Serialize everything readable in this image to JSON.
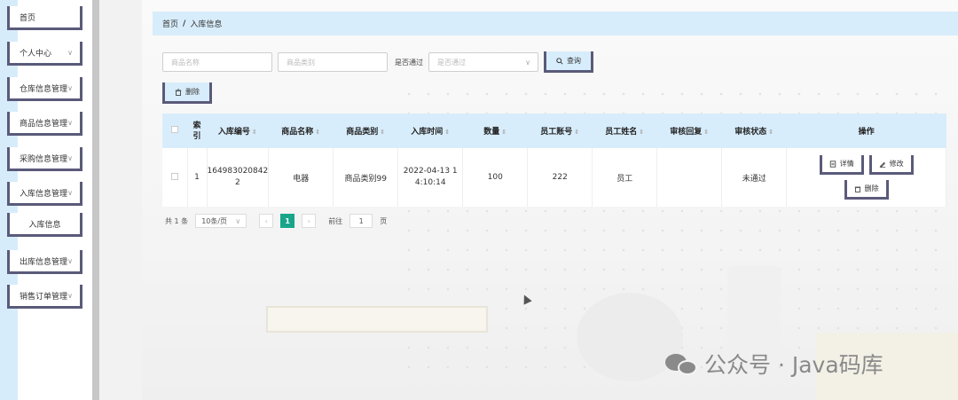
{
  "sidebar": {
    "items": [
      {
        "label": "首页",
        "has_chevron": false
      },
      {
        "label": "个人中心",
        "has_chevron": true
      },
      {
        "label": "仓库信息管理",
        "has_chevron": true
      },
      {
        "label": "商品信息管理",
        "has_chevron": true
      },
      {
        "label": "采购信息管理",
        "has_chevron": true
      },
      {
        "label": "入库信息管理",
        "has_chevron": true
      },
      {
        "label": "入库信息",
        "has_chevron": false
      },
      {
        "label": "出库信息管理",
        "has_chevron": true
      },
      {
        "label": "销售订单管理",
        "has_chevron": true
      }
    ],
    "chevron": "∨"
  },
  "breadcrumb": {
    "home": "首页",
    "separator": "/",
    "current": "入库信息"
  },
  "search": {
    "name_placeholder": "商品名称",
    "category_placeholder": "商品类别",
    "approved_label": "是否通过",
    "approved_placeholder": "是否通过",
    "query_button": "查询",
    "search_icon": "search-icon"
  },
  "toolbar": {
    "delete_button": "删除",
    "delete_icon": "trash-icon"
  },
  "table": {
    "headers": [
      "索引",
      "入库编号",
      "商品名称",
      "商品类别",
      "入库时间",
      "数量",
      "员工账号",
      "员工姓名",
      "审核回复",
      "审核状态",
      "操作"
    ],
    "index_header_l1": "索",
    "index_header_l2": "引",
    "rows": [
      {
        "index": "1",
        "code_l1": "164983020842",
        "code_l2": "2",
        "name": "电器",
        "category": "商品类别99",
        "time_l1": "2022-04-13 1",
        "time_l2": "4:10:14",
        "quantity": "100",
        "staff_account": "222",
        "staff_name": "员工",
        "review_reply": "",
        "review_status": "未通过",
        "actions": {
          "detail": "详情",
          "edit": "修改",
          "delete": "删除"
        }
      }
    ]
  },
  "pagination": {
    "total": "共 1 条",
    "page_size": "10条/页",
    "prev": "‹",
    "current_page": "1",
    "next": "›",
    "goto_label": "前往",
    "goto_value": "1",
    "page_unit": "页"
  },
  "watermark": {
    "text": "公众号 · Java码库"
  },
  "colors": {
    "accent": "#d8edfb",
    "border": "#5a5a7a",
    "pager_active": "#19a58a"
  }
}
